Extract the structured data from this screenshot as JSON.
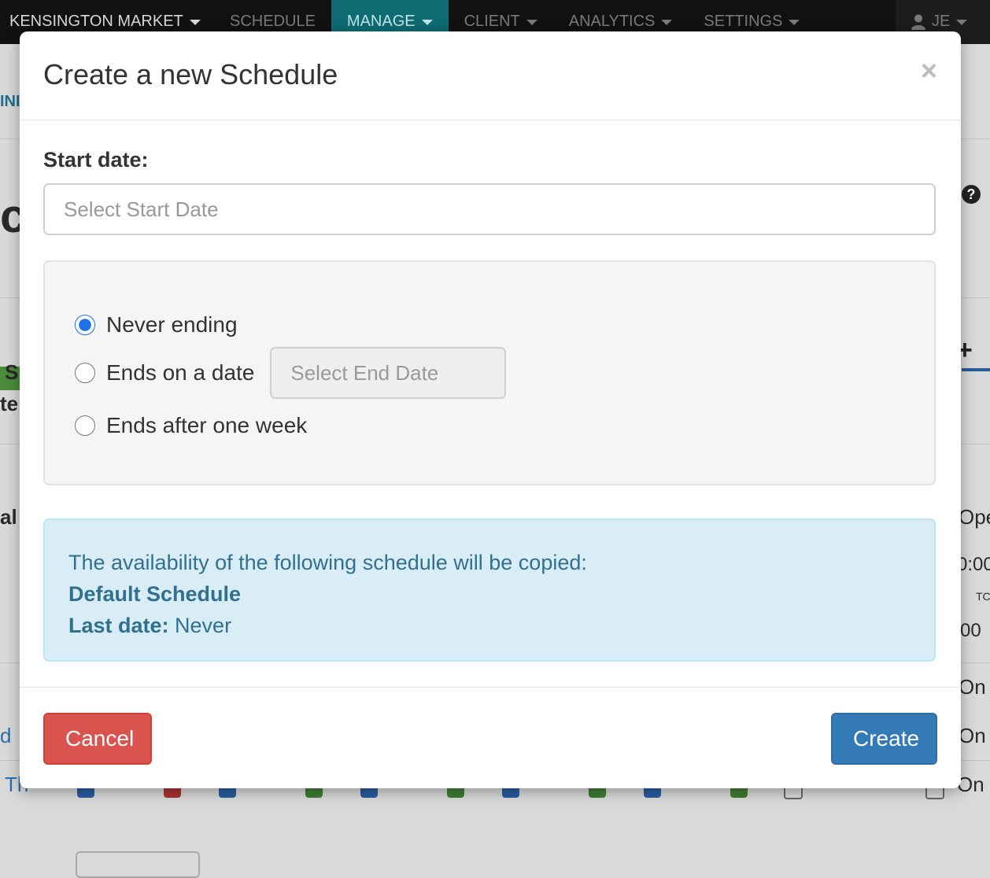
{
  "background": {
    "nav": {
      "brand": "KENSINGTON MARKET",
      "items": [
        {
          "label": "SCHEDULE",
          "active": false,
          "caret": false
        },
        {
          "label": "MANAGE",
          "active": true,
          "caret": true
        },
        {
          "label": "CLIENT",
          "active": false,
          "caret": true
        },
        {
          "label": "ANALYTICS",
          "active": false,
          "caret": true
        },
        {
          "label": "SETTINGS",
          "active": false,
          "caret": true
        }
      ],
      "user": "JE"
    },
    "fragments": {
      "a": "INI",
      "b": "c",
      "c": "S",
      "d": "te",
      "e": "al",
      "f": "d",
      "g": "Th",
      "h": "Ope",
      "i": "0:00",
      "j": "TC",
      "k": "00",
      "l": "On",
      "m": "On",
      "n": "On"
    }
  },
  "modal": {
    "title": "Create a new Schedule",
    "close_symbol": "×",
    "start_date": {
      "label": "Start date:",
      "placeholder": "Select Start Date",
      "value": ""
    },
    "end_options": [
      {
        "label": "Never ending",
        "checked": true
      },
      {
        "label": "Ends on a date",
        "checked": false,
        "input_placeholder": "Select End Date"
      },
      {
        "label": "Ends after one week",
        "checked": false
      }
    ],
    "info": {
      "intro": "The availability of the following schedule will be copied:",
      "schedule_name": "Default Schedule",
      "last_date_label": "Last date:",
      "last_date_value": "Never"
    },
    "buttons": {
      "cancel": "Cancel",
      "create": "Create"
    }
  },
  "colors": {
    "cancel": "#d9534f",
    "create": "#337ab7",
    "info_bg": "#d9edf7",
    "info_text": "#31708f",
    "nav_active": "#0e6b72"
  }
}
